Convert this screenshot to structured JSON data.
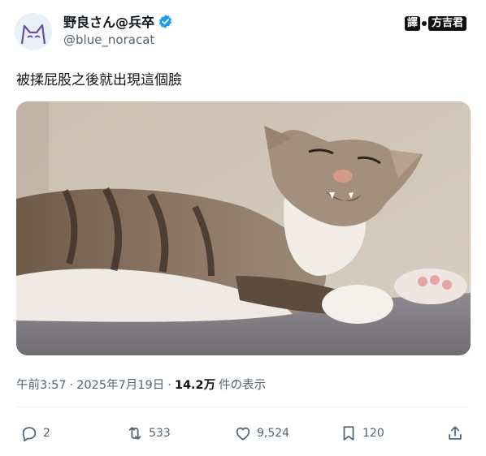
{
  "author": {
    "display_name": "野良さん@兵卒",
    "handle": "@blue_noracat",
    "verified": true,
    "avatar_icon": "cat-avatar-icon"
  },
  "watermark": {
    "part1": "譯",
    "part2": "方吉君"
  },
  "tweet": {
    "text": "被揉屁股之後就出現這個臉"
  },
  "photo": {
    "icon": "cat-photo"
  },
  "meta": {
    "time": "午前3:57",
    "separator1": "·",
    "date": "2025年7月19日",
    "separator2": "·",
    "views_count": "14.2万",
    "views_label": "件の表示"
  },
  "actions": {
    "replies": "2",
    "retweets": "533",
    "likes": "9,524",
    "bookmarks": "120"
  },
  "colors": {
    "text": "#0f1419",
    "secondary": "#536471",
    "verified": "#1d9bf0"
  }
}
